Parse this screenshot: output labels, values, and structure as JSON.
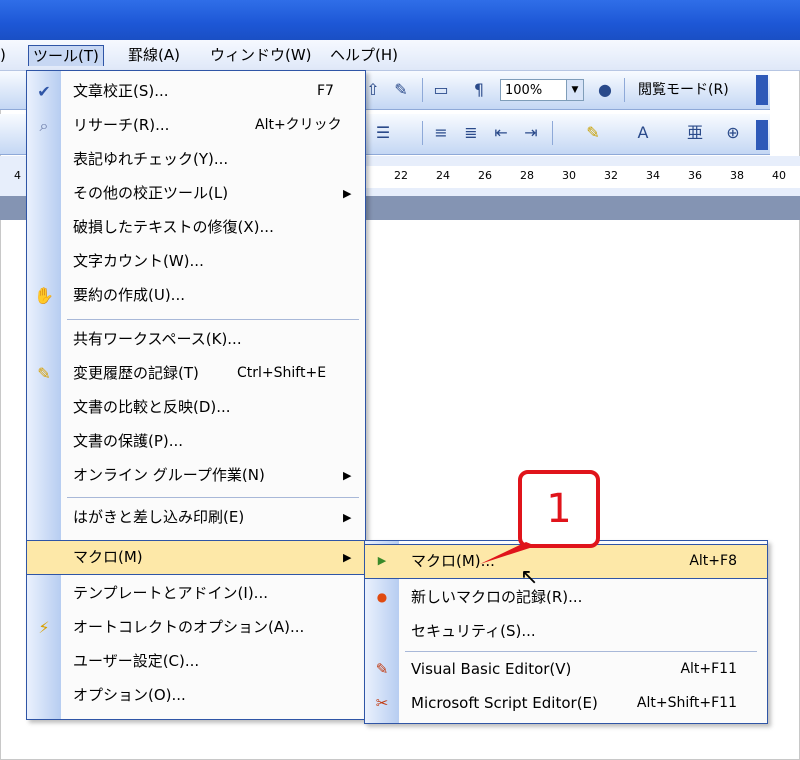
{
  "menubar": {
    "items": [
      {
        "label": "ツール(T)"
      },
      {
        "label": "罫線(A)"
      },
      {
        "label": "ウィンドウ(W)"
      },
      {
        "label": "ヘルプ(H)"
      }
    ]
  },
  "toolbar": {
    "zoom": "100%",
    "read_mode": "閲覧モード(R)"
  },
  "ruler": {
    "ticks": [
      "4",
      "22",
      "24",
      "26",
      "28",
      "30",
      "32",
      "34",
      "36",
      "38",
      "40"
    ]
  },
  "tools_menu": {
    "items": [
      {
        "label": "文章校正(S)...",
        "shortcut": "F7"
      },
      {
        "label": "リサーチ(R)...",
        "shortcut": "Alt+クリック"
      },
      {
        "label": "表記ゆれチェック(Y)..."
      },
      {
        "label": "その他の校正ツール(L)"
      },
      {
        "label": "破損したテキストの修復(X)..."
      },
      {
        "label": "文字カウント(W)..."
      },
      {
        "label": "要約の作成(U)..."
      },
      {
        "label": "共有ワークスペース(K)..."
      },
      {
        "label": "変更履歴の記録(T)",
        "shortcut": "Ctrl+Shift+E"
      },
      {
        "label": "文書の比較と反映(D)..."
      },
      {
        "label": "文書の保護(P)..."
      },
      {
        "label": "オンライン グループ作業(N)"
      },
      {
        "label": "はがきと差し込み印刷(E)"
      },
      {
        "label": "マクロ(M)"
      },
      {
        "label": "テンプレートとアドイン(I)..."
      },
      {
        "label": "オートコレクトのオプション(A)..."
      },
      {
        "label": "ユーザー設定(C)..."
      },
      {
        "label": "オプション(O)..."
      }
    ]
  },
  "macro_submenu": {
    "items": [
      {
        "label": "マクロ(M)...",
        "shortcut": "Alt+F8"
      },
      {
        "label": "新しいマクロの記録(R)..."
      },
      {
        "label": "セキュリティ(S)..."
      },
      {
        "label": "Visual Basic Editor(V)",
        "shortcut": "Alt+F11"
      },
      {
        "label": "Microsoft Script Editor(E)",
        "shortcut": "Alt+Shift+F11"
      }
    ]
  },
  "callout": {
    "number": "1"
  },
  "colors": {
    "titlebar": "#1d57d6",
    "highlight": "#fde8a8",
    "callout_red": "#e0141b"
  }
}
